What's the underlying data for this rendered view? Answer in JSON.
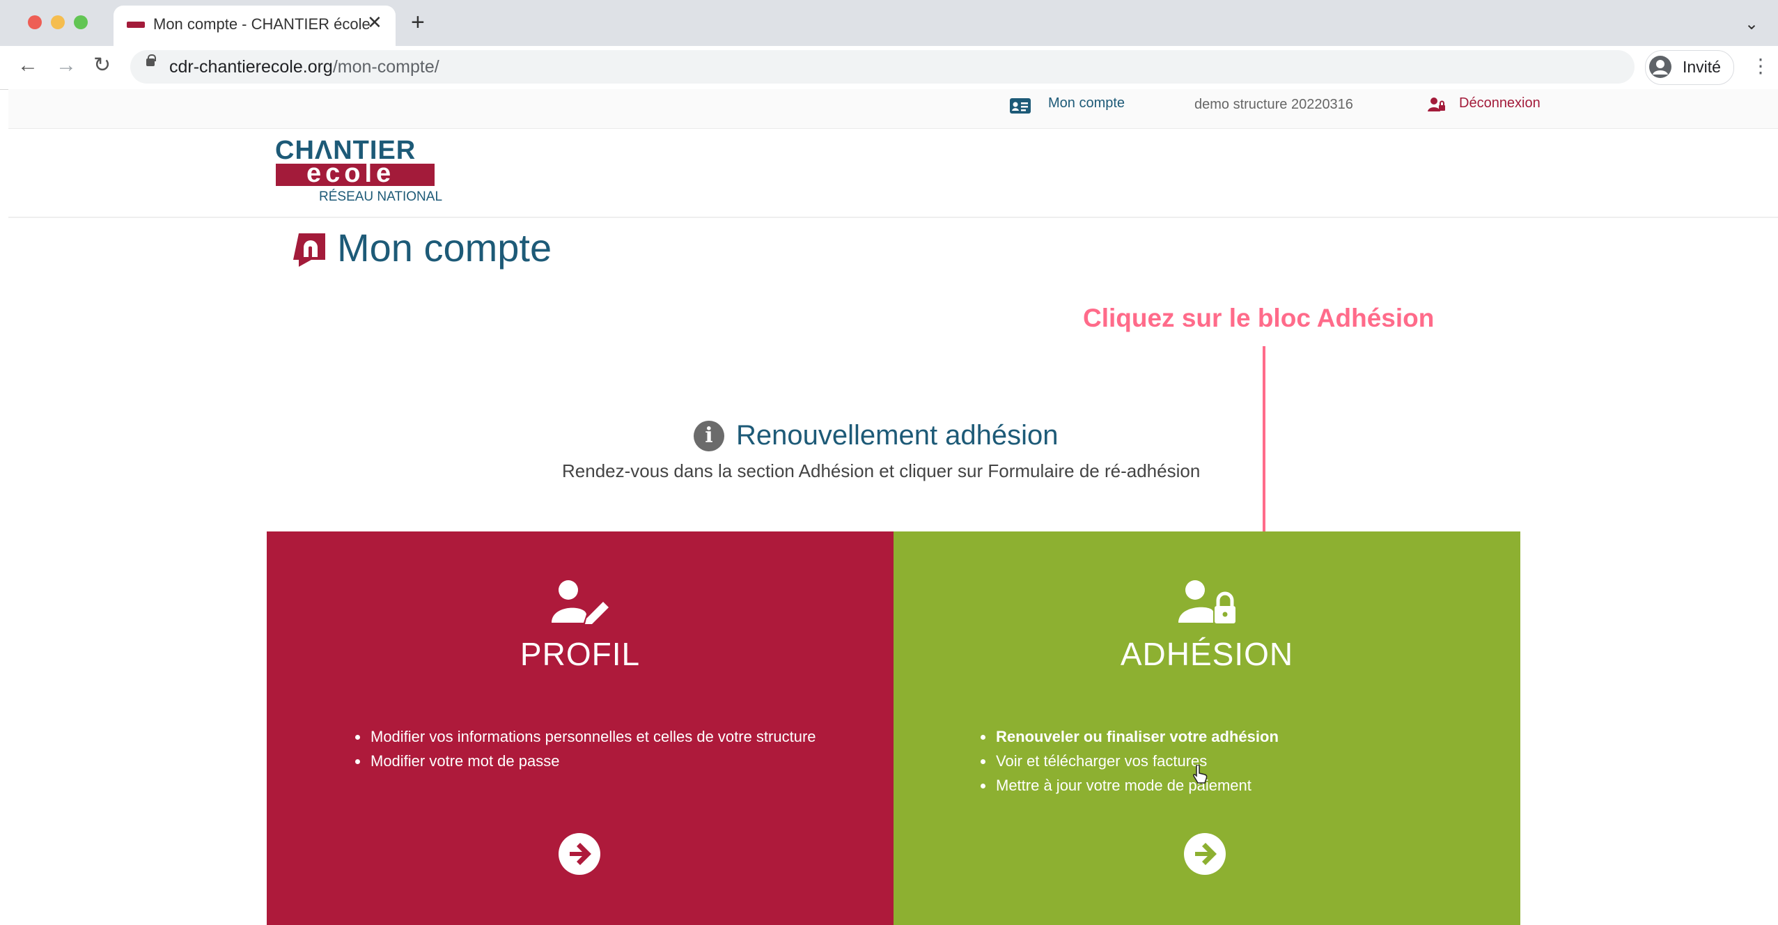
{
  "browser": {
    "tab_title": "Mon compte - CHANTIER école",
    "tab_close": "✕",
    "new_tab": "+",
    "tab_menu": "⌄",
    "nav": {
      "back": "←",
      "forward": "→",
      "reload": "↻"
    },
    "url_domain": "cdr-chantierecole.org",
    "url_path": "/mon-compte/",
    "profile_label": "Invité",
    "menu": "⋮"
  },
  "site": {
    "topbar": {
      "account_link": "Mon compte",
      "org_name": "demo structure 20220316",
      "logout_link": "Déconnexion"
    },
    "logo": {
      "line1": "CHΛNTIER",
      "line2": "ecole",
      "line3": "RÉSEAU NATIONAL"
    },
    "page_title": "Mon compte"
  },
  "annotation": {
    "text": "Cliquez sur le bloc Adhésion",
    "color": "#ff6b8a"
  },
  "info": {
    "icon": "i",
    "title": "Renouvellement adhésion",
    "text": "Rendez-vous dans la section Adhésion et cliquer sur Formulaire de ré-adhésion"
  },
  "cards": [
    {
      "title": "PROFIL",
      "color": "#ae1a3b",
      "icon": "user-edit-icon",
      "items": [
        "Modifier vos informations personnelles et celles de votre structure",
        "Modifier votre mot de passe"
      ]
    },
    {
      "title": "ADHÉSION",
      "color": "#8db031",
      "icon": "user-lock-icon",
      "items": [
        "Renouveler ou finaliser votre adhésion",
        "Voir et télécharger vos factures",
        "Mettre à jour votre mode de paiement"
      ]
    }
  ],
  "colors": {
    "brand_blue": "#1d5a77",
    "brand_red": "#a31b3a",
    "adhesion_green": "#8db031"
  }
}
